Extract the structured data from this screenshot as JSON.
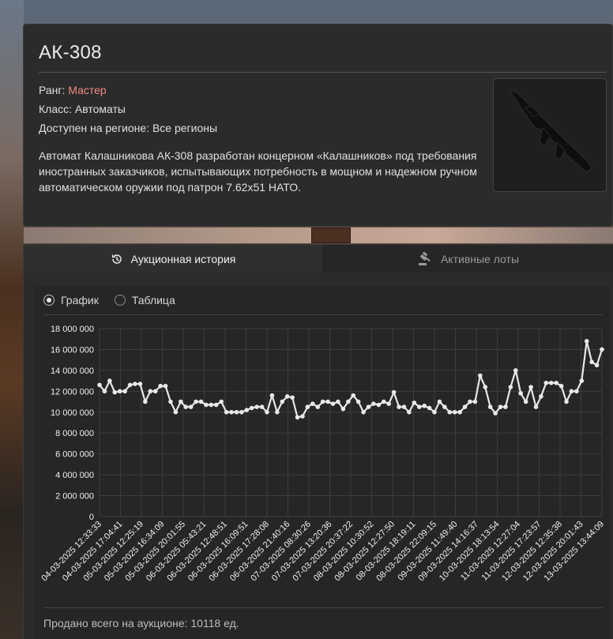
{
  "item": {
    "name": "АК-308",
    "rank_label": "Ранг:",
    "rank_value": "Мастер",
    "class_line": "Класс: Автоматы",
    "region_line": "Доступен на регионе: Все регионы",
    "description": "Автомат Калашникова АК-308 разработан концерном «Калашников» под требования иностранных заказчиков, испытывающих потребность в мощном и надежном ручном автоматическом оружии под патрон 7.62х51 НАТО."
  },
  "tabs": [
    {
      "label": "Аукционная история",
      "icon": "history-icon",
      "active": true
    },
    {
      "label": "Активные лоты",
      "icon": "gavel-icon",
      "active": false
    }
  ],
  "view_toggle": {
    "options": [
      {
        "label": "График",
        "checked": true
      },
      {
        "label": "Таблица",
        "checked": false
      }
    ]
  },
  "footer_text": "Продано всего на аукционе: 10118 ед.",
  "colors": {
    "rank": "#f08a80",
    "line": "#e8e8e8",
    "grid": "#3e3e3e"
  },
  "chart_data": {
    "type": "line",
    "title": "",
    "xlabel": "",
    "ylabel": "",
    "ylim": [
      0,
      18000000
    ],
    "yticks": [
      "18 000 000",
      "16 000 000",
      "14 000 000",
      "12 000 000",
      "10 000 000",
      "8 000 000",
      "6 000 000",
      "4 000 000",
      "2 000 000",
      "0"
    ],
    "x_tick_labels": [
      "04-03-2025 12:33:33",
      "04-03-2025 17:04:41",
      "05-03-2025 12:25:19",
      "05-03-2025 16:34:09",
      "05-03-2025 20:01:55",
      "06-03-2025 05:43:21",
      "06-03-2025 12:48:51",
      "06-03-2025 16:09:51",
      "06-03-2025 17:28:08",
      "06-03-2025 21:40:16",
      "07-03-2025 08:30:26",
      "07-03-2025 13:20:36",
      "07-03-2025 20:37:22",
      "08-03-2025 10:30:52",
      "08-03-2025 12:27:50",
      "08-03-2025 18:19:11",
      "08-03-2025 22:09:15",
      "09-03-2025 11:49:40",
      "09-03-2025 14:16:37",
      "10-03-2025 18:13:54",
      "11-03-2025 12:27:04",
      "11-03-2025 17:23:57",
      "12-03-2025 12:35:38",
      "12-03-2025 20:01:43",
      "13-03-2025 13:44:09"
    ],
    "grid": true,
    "series": [
      {
        "values": [
          12600000,
          12000000,
          13000000,
          11900000,
          12000000,
          12000000,
          12600000,
          12700000,
          12700000,
          11000000,
          12000000,
          12000000,
          12500000,
          12500000,
          11000000,
          10000000,
          11000000,
          10500000,
          10500000,
          11000000,
          11000000,
          10700000,
          10700000,
          10700000,
          11000000,
          10000000,
          10000000,
          10000000,
          10000000,
          10200000,
          10400000,
          10500000,
          10500000,
          10000000,
          11600000,
          10000000,
          11000000,
          11500000,
          11400000,
          9500000,
          9600000,
          10500000,
          10800000,
          10500000,
          11000000,
          11000000,
          10800000,
          11000000,
          10300000,
          11000000,
          11600000,
          11000000,
          10000000,
          10500000,
          10800000,
          10700000,
          11000000,
          10800000,
          11900000,
          10500000,
          10500000,
          10000000,
          10900000,
          10500000,
          10600000,
          10400000,
          10000000,
          11000000,
          10500000,
          10000000,
          10000000,
          10000000,
          10500000,
          11000000,
          11000000,
          13500000,
          12400000,
          10500000,
          9900000,
          10500000,
          10500000,
          12400000,
          14000000,
          11800000,
          11000000,
          12400000,
          10500000,
          11500000,
          12800000,
          12800000,
          12800000,
          12500000,
          11000000,
          12000000,
          12000000,
          13000000,
          16800000,
          14800000,
          14500000,
          16000000
        ]
      }
    ]
  }
}
